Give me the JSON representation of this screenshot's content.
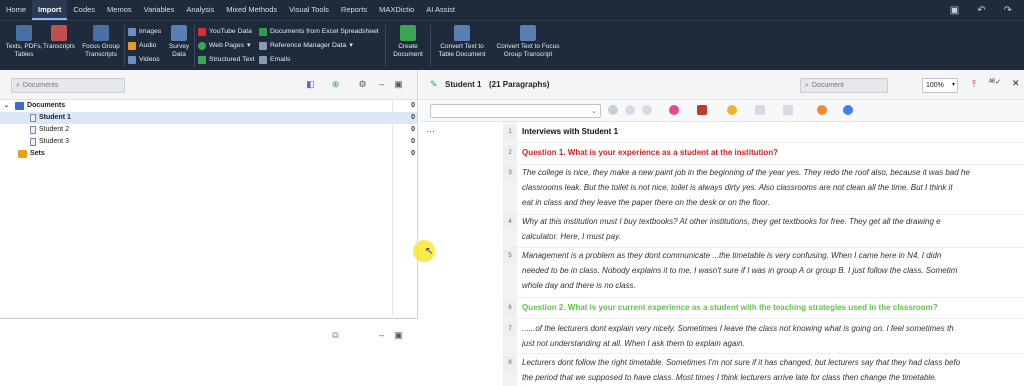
{
  "menu": {
    "tabs": [
      "Home",
      "Import",
      "Codes",
      "Memos",
      "Variables",
      "Analysis",
      "Mixed Methods",
      "Visual Tools",
      "Reports",
      "MAXDictio",
      "AI Assist"
    ],
    "active_tab": "Import"
  },
  "ribbon": {
    "texts_pdfs_tables": "Texts, PDFs, Tables",
    "transcripts": "Transcripts",
    "focus_group_transcripts": "Focus Group Transcripts",
    "images": "Images",
    "audio": "Audio",
    "videos": "Videos",
    "survey_data": "Survey Data",
    "youtube_data": "YouTube Data",
    "web_pages": "Web Pages",
    "structured_text": "Structured Text",
    "docs_from_excel": "Documents from Excel Spreadsheet",
    "reference_manager_data": "Reference Manager Data",
    "emails": "Emails",
    "create_document": "Create Document",
    "convert_to_table": "Convert Text to Table Document",
    "convert_to_focus_group": "Convert Text to Focus Group Transcript"
  },
  "left_panel": {
    "search_placeholder": "Documents",
    "tree": [
      {
        "label": "Documents",
        "count": "0",
        "type": "root"
      },
      {
        "label": "Student 1",
        "count": "0",
        "type": "doc",
        "selected": true
      },
      {
        "label": "Student 2",
        "count": "0",
        "type": "doc"
      },
      {
        "label": "Student 3",
        "count": "0",
        "type": "doc"
      },
      {
        "label": "Sets",
        "count": "0",
        "type": "sets"
      }
    ]
  },
  "document": {
    "title": "Student 1",
    "paragraphs_label": "(21 Paragraphs)",
    "search_placeholder": "Document",
    "zoom": "100%",
    "lines": [
      {
        "num": "1",
        "text": "Interviews with Student 1",
        "style": "h1"
      },
      {
        "num": "2",
        "text": "Question 1. What is your experience as a student at the institution?",
        "style": "red"
      },
      {
        "num": "3",
        "text": "The college is nice, they make a new paint job in the beginning of the year yes. They redo the roof also, because it was bad he",
        "text2": "classrooms leak. But the toilet is not nice, toilet is always dirty yes. Also classrooms are not clean all the time. But I think it",
        "text3": "eat in class and they leave the paper there on the desk or on the floor.",
        "style": "i"
      },
      {
        "num": "4",
        "text": "Why at this institution must I buy textbooks? At other institutions, they get textbooks for free. They get all the drawing e",
        "text2": "calculator. Here, I must pay.",
        "style": "i"
      },
      {
        "num": "5",
        "text": " Management is a problem as they dont communicate ...the timetable is very confusing. When I came here in N4, I didn",
        "text2": "needed to be in class. Nobody explains it to me, I wasn't sure if I was in group A or group B. I just follow the class. Sometim",
        "text3": "whole day and there is no class.",
        "style": "i"
      },
      {
        "num": "6",
        "text": "Question 2. What is your current experience as a student with the teaching strategies used in the classroom?",
        "style": "green"
      },
      {
        "num": "7",
        "text": "......of the lecturers dont explain very nicely. Sometimes I leave the class not knowing what is going on. I feel sometimes th",
        "text2": "just not understanding at all. When I ask them to explain again.",
        "style": "i"
      },
      {
        "num": "8",
        "text": "Lecturers dont follow the right timetable. Sometimes I'm not sure if it has changed, but lecturers say that they had class befo",
        "text2": "the period that we supposed to have class. Most times I think lecturers arrive late for class then change the timetable.",
        "style": "i"
      }
    ]
  },
  "colors": {
    "menubar_bg": "#1f2a3a",
    "question_red": "#e01c1c",
    "question_green": "#62c24a",
    "selection": "#dbe6f7"
  }
}
